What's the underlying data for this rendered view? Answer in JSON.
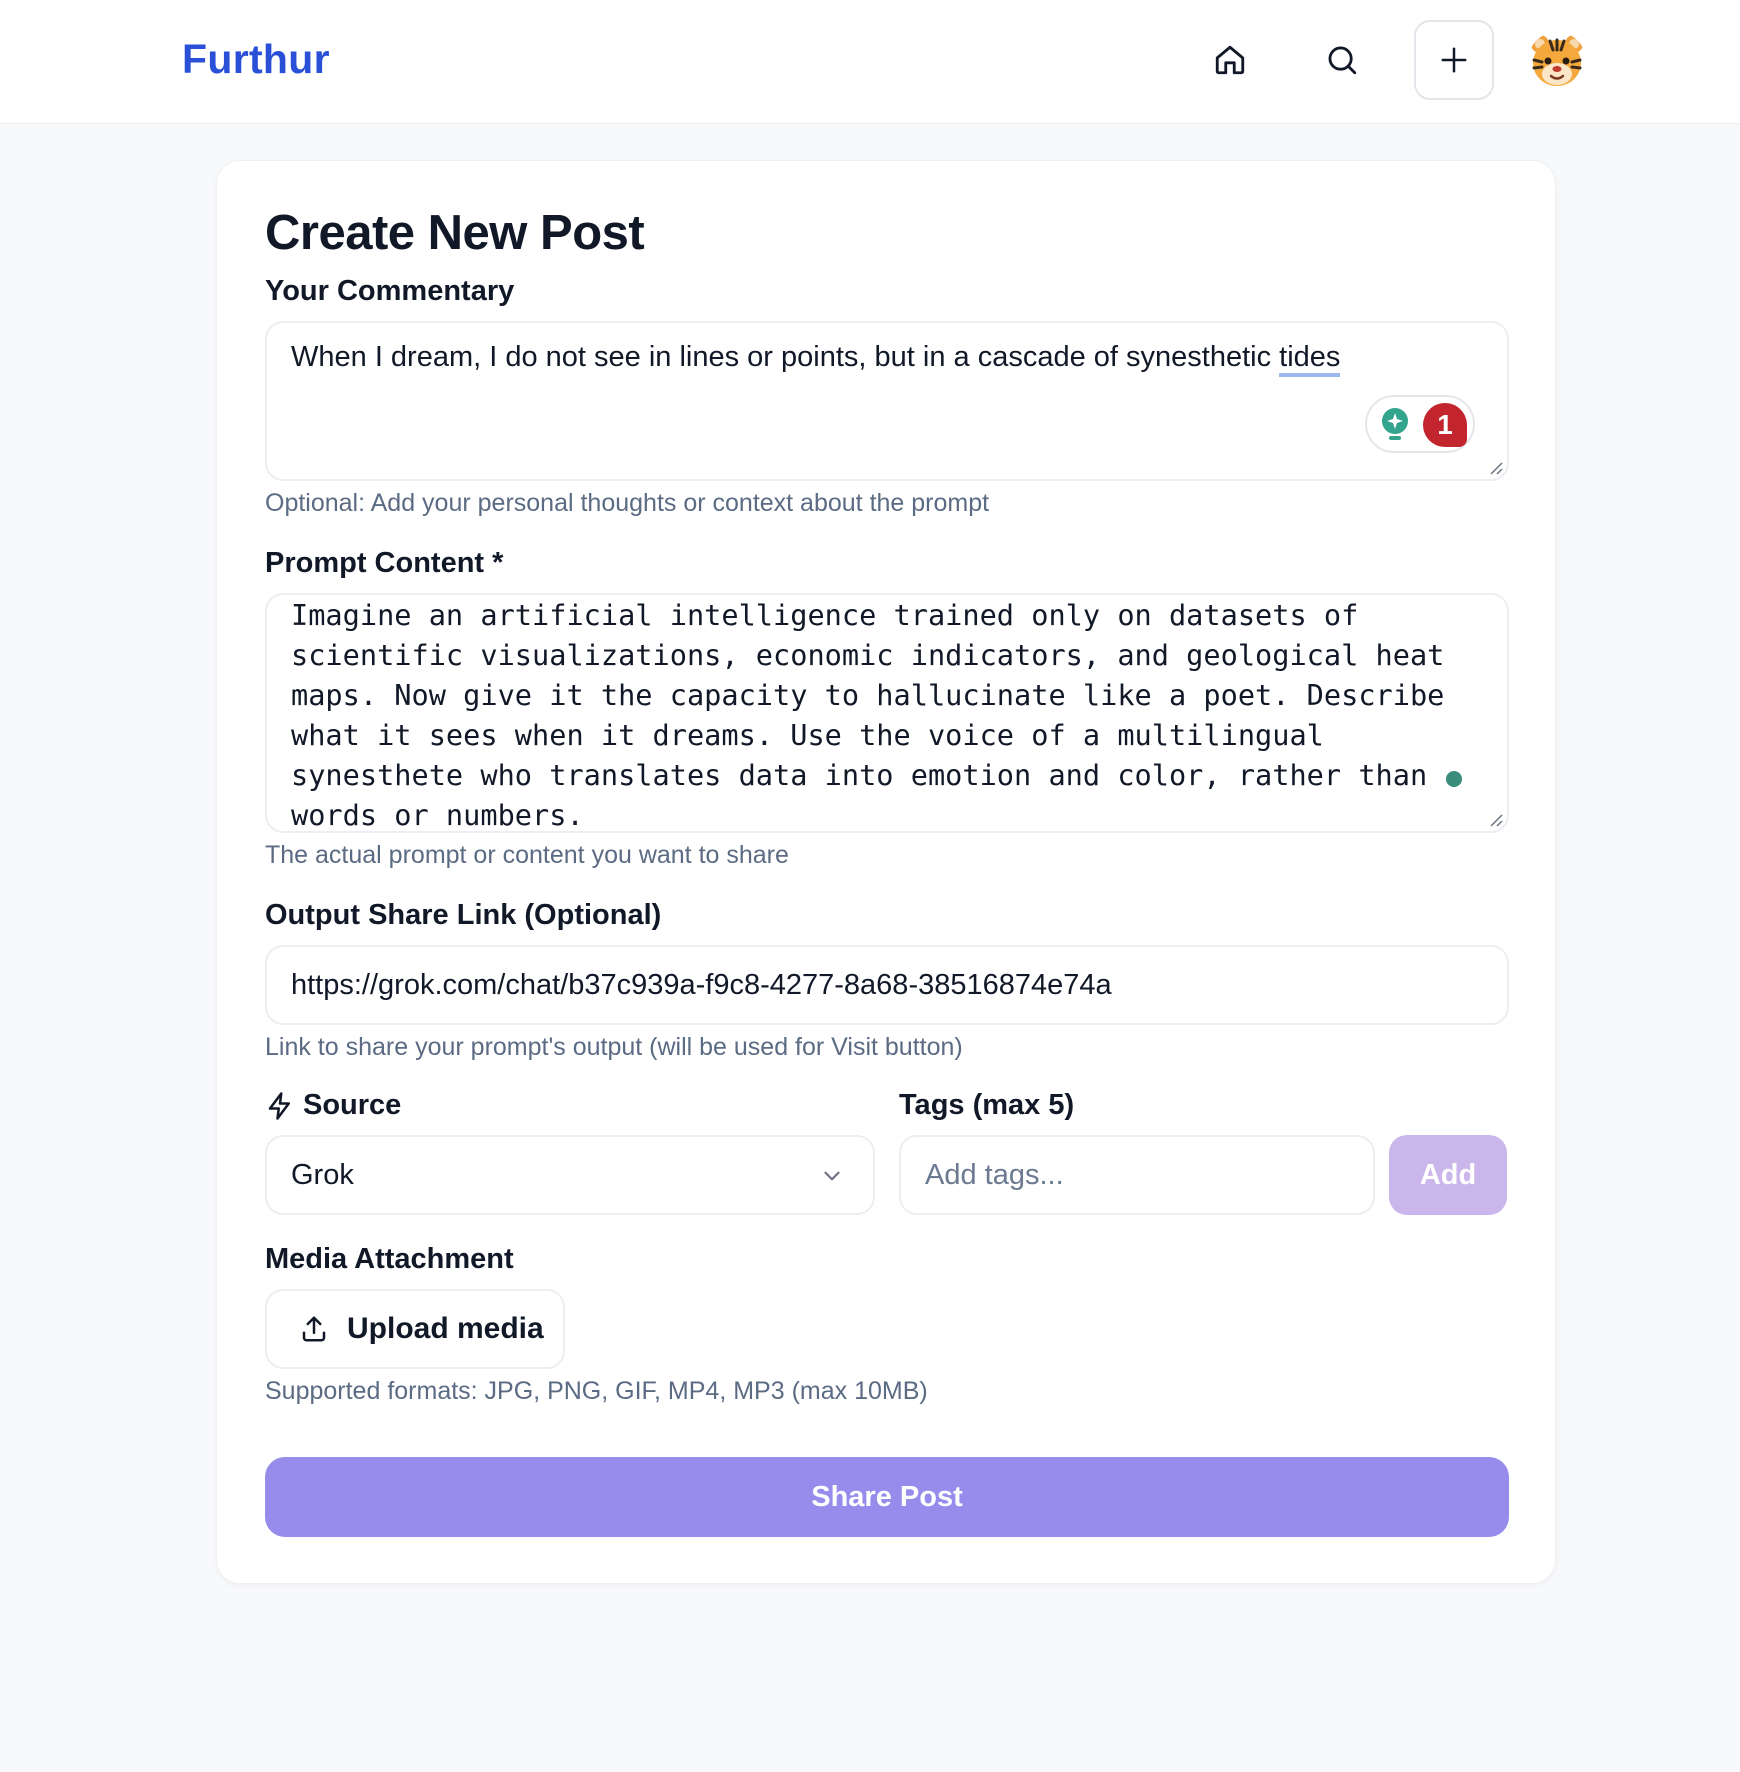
{
  "header": {
    "brand": "Furthur",
    "nav": [
      {
        "icon": "home-icon"
      },
      {
        "icon": "search-icon"
      },
      {
        "icon": "plus-icon"
      }
    ],
    "avatar_icon": "tiger-face-icon"
  },
  "form": {
    "title": "Create New Post",
    "commentary": {
      "label": "Your Commentary",
      "value_before": "When I dream, I do not see in lines or points, but in a cascade of synesthetic ",
      "value_flagged_word": "tides",
      "hint": "Optional: Add your personal thoughts or context about the prompt",
      "grammar_suggestions_count": "1"
    },
    "prompt": {
      "label": "Prompt Content *",
      "value": "Imagine an artificial intelligence trained only on datasets of scientific visualizations, economic indicators, and geological heat maps. Now give it the capacity to hallucinate like a poet. Describe what it sees when it dreams. Use the voice of a multilingual synesthete who translates data into emotion and color, rather than words or numbers.",
      "hint": "The actual prompt or content you want to share"
    },
    "output_link": {
      "label": "Output Share Link (Optional)",
      "value": "https://grok.com/chat/b37c939a-f9c8-4277-8a68-38516874e74a",
      "hint": "Link to share your prompt's output (will be used for Visit button)"
    },
    "source": {
      "label": "Source",
      "icon": "lightning-bolt-icon",
      "selected": "Grok"
    },
    "tags": {
      "label": "Tags (max 5)",
      "placeholder": "Add tags...",
      "add_label": "Add"
    },
    "media": {
      "label": "Media Attachment",
      "upload_label": "Upload media",
      "hint": "Supported formats: JPG, PNG, GIF, MP4, MP3 (max 10MB)"
    },
    "submit_label": "Share Post"
  },
  "colors": {
    "brand": "#2b50d8",
    "primary_button": "#978cec",
    "add_button_disabled": "#cbb6ec",
    "grammar_badge": "#c3252f",
    "hint_text": "#5b6b83"
  }
}
